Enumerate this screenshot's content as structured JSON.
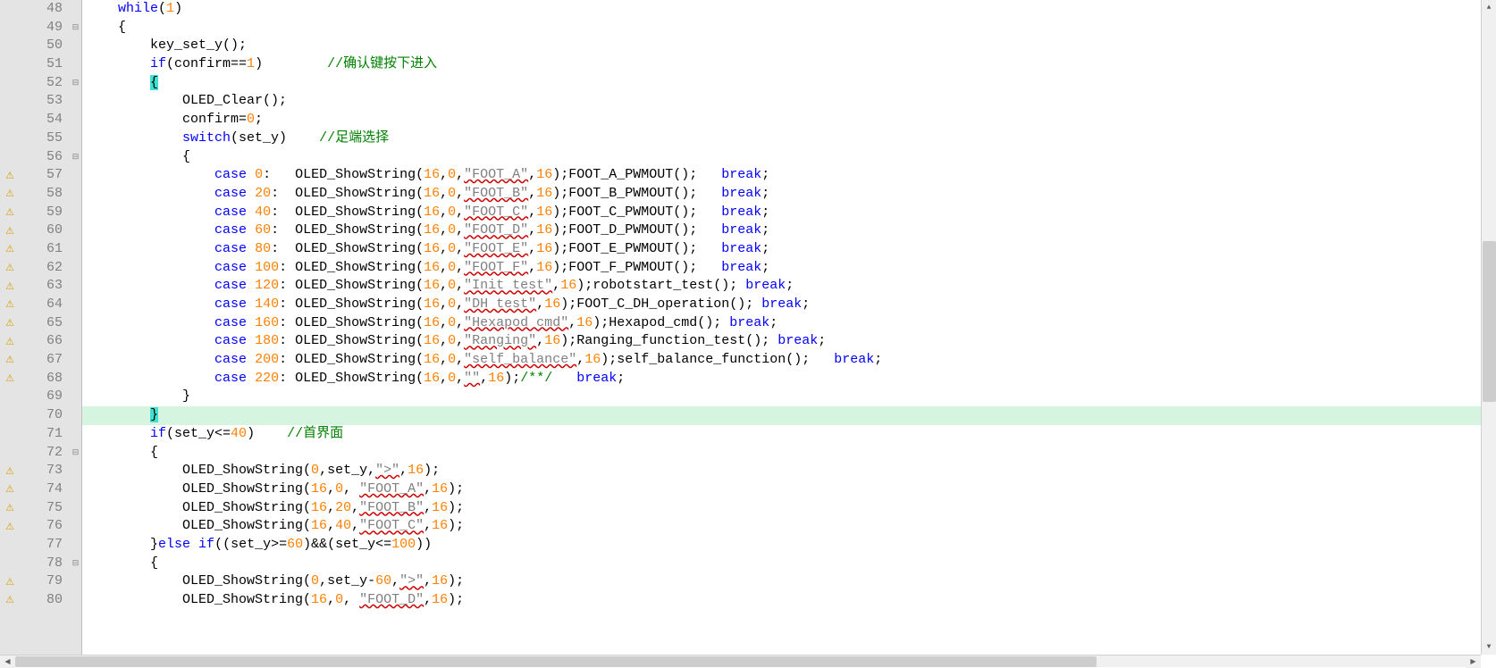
{
  "lines": [
    {
      "num": 48,
      "warn": false,
      "fold": "",
      "tokens": [
        [
          "    ",
          "ident"
        ],
        [
          "while",
          "kw"
        ],
        [
          "(",
          "ident"
        ],
        [
          "1",
          "num"
        ],
        [
          ")",
          "ident"
        ]
      ]
    },
    {
      "num": 49,
      "warn": false,
      "fold": "minus",
      "tokens": [
        [
          "    {",
          "ident"
        ]
      ]
    },
    {
      "num": 50,
      "warn": false,
      "fold": "",
      "tokens": [
        [
          "        key_set_y();",
          "ident"
        ]
      ]
    },
    {
      "num": 51,
      "warn": false,
      "fold": "",
      "tokens": [
        [
          "        ",
          "ident"
        ],
        [
          "if",
          "kw"
        ],
        [
          "(confirm==",
          "ident"
        ],
        [
          "1",
          "num"
        ],
        [
          ")        ",
          "ident"
        ],
        [
          "//确认键按下进入",
          "com"
        ]
      ]
    },
    {
      "num": 52,
      "warn": false,
      "fold": "minus",
      "tokens": [
        [
          "        ",
          "ident"
        ],
        [
          "{",
          "brace-hl"
        ]
      ]
    },
    {
      "num": 53,
      "warn": false,
      "fold": "",
      "tokens": [
        [
          "            OLED_Clear();",
          "ident"
        ]
      ]
    },
    {
      "num": 54,
      "warn": false,
      "fold": "",
      "tokens": [
        [
          "            confirm=",
          "ident"
        ],
        [
          "0",
          "num"
        ],
        [
          ";",
          "ident"
        ]
      ]
    },
    {
      "num": 55,
      "warn": false,
      "fold": "",
      "tokens": [
        [
          "            ",
          "ident"
        ],
        [
          "switch",
          "kw"
        ],
        [
          "(set_y)    ",
          "ident"
        ],
        [
          "//足端选择",
          "com"
        ]
      ]
    },
    {
      "num": 56,
      "warn": false,
      "fold": "minus",
      "tokens": [
        [
          "            {",
          "ident"
        ]
      ]
    },
    {
      "num": 57,
      "warn": true,
      "fold": "",
      "tokens": [
        [
          "                ",
          "ident"
        ],
        [
          "case",
          "kw"
        ],
        [
          " ",
          "ident"
        ],
        [
          "0",
          "num"
        ],
        [
          ":   OLED_ShowString(",
          "ident"
        ],
        [
          "16",
          "num"
        ],
        [
          ",",
          "ident"
        ],
        [
          "0",
          "num"
        ],
        [
          ",",
          "ident"
        ],
        [
          "\"FOOT_A\"",
          "str-underline"
        ],
        [
          ",",
          "ident"
        ],
        [
          "16",
          "num"
        ],
        [
          ");FOOT_A_PWMOUT();   ",
          "ident"
        ],
        [
          "break",
          "kw"
        ],
        [
          ";",
          "ident"
        ]
      ]
    },
    {
      "num": 58,
      "warn": true,
      "fold": "",
      "tokens": [
        [
          "                ",
          "ident"
        ],
        [
          "case",
          "kw"
        ],
        [
          " ",
          "ident"
        ],
        [
          "20",
          "num"
        ],
        [
          ":  OLED_ShowString(",
          "ident"
        ],
        [
          "16",
          "num"
        ],
        [
          ",",
          "ident"
        ],
        [
          "0",
          "num"
        ],
        [
          ",",
          "ident"
        ],
        [
          "\"FOOT_B\"",
          "str-underline"
        ],
        [
          ",",
          "ident"
        ],
        [
          "16",
          "num"
        ],
        [
          ");FOOT_B_PWMOUT();   ",
          "ident"
        ],
        [
          "break",
          "kw"
        ],
        [
          ";",
          "ident"
        ]
      ]
    },
    {
      "num": 59,
      "warn": true,
      "fold": "",
      "tokens": [
        [
          "                ",
          "ident"
        ],
        [
          "case",
          "kw"
        ],
        [
          " ",
          "ident"
        ],
        [
          "40",
          "num"
        ],
        [
          ":  OLED_ShowString(",
          "ident"
        ],
        [
          "16",
          "num"
        ],
        [
          ",",
          "ident"
        ],
        [
          "0",
          "num"
        ],
        [
          ",",
          "ident"
        ],
        [
          "\"FOOT_C\"",
          "str-underline"
        ],
        [
          ",",
          "ident"
        ],
        [
          "16",
          "num"
        ],
        [
          ");FOOT_C_PWMOUT();   ",
          "ident"
        ],
        [
          "break",
          "kw"
        ],
        [
          ";",
          "ident"
        ]
      ]
    },
    {
      "num": 60,
      "warn": true,
      "fold": "",
      "tokens": [
        [
          "                ",
          "ident"
        ],
        [
          "case",
          "kw"
        ],
        [
          " ",
          "ident"
        ],
        [
          "60",
          "num"
        ],
        [
          ":  OLED_ShowString(",
          "ident"
        ],
        [
          "16",
          "num"
        ],
        [
          ",",
          "ident"
        ],
        [
          "0",
          "num"
        ],
        [
          ",",
          "ident"
        ],
        [
          "\"FOOT_D\"",
          "str-underline"
        ],
        [
          ",",
          "ident"
        ],
        [
          "16",
          "num"
        ],
        [
          ");FOOT_D_PWMOUT();   ",
          "ident"
        ],
        [
          "break",
          "kw"
        ],
        [
          ";",
          "ident"
        ]
      ]
    },
    {
      "num": 61,
      "warn": true,
      "fold": "",
      "tokens": [
        [
          "                ",
          "ident"
        ],
        [
          "case",
          "kw"
        ],
        [
          " ",
          "ident"
        ],
        [
          "80",
          "num"
        ],
        [
          ":  OLED_ShowString(",
          "ident"
        ],
        [
          "16",
          "num"
        ],
        [
          ",",
          "ident"
        ],
        [
          "0",
          "num"
        ],
        [
          ",",
          "ident"
        ],
        [
          "\"FOOT_E\"",
          "str-underline"
        ],
        [
          ",",
          "ident"
        ],
        [
          "16",
          "num"
        ],
        [
          ");FOOT_E_PWMOUT();   ",
          "ident"
        ],
        [
          "break",
          "kw"
        ],
        [
          ";",
          "ident"
        ]
      ]
    },
    {
      "num": 62,
      "warn": true,
      "fold": "",
      "tokens": [
        [
          "                ",
          "ident"
        ],
        [
          "case",
          "kw"
        ],
        [
          " ",
          "ident"
        ],
        [
          "100",
          "num"
        ],
        [
          ": OLED_ShowString(",
          "ident"
        ],
        [
          "16",
          "num"
        ],
        [
          ",",
          "ident"
        ],
        [
          "0",
          "num"
        ],
        [
          ",",
          "ident"
        ],
        [
          "\"FOOT_F\"",
          "str-underline"
        ],
        [
          ",",
          "ident"
        ],
        [
          "16",
          "num"
        ],
        [
          ");FOOT_F_PWMOUT();   ",
          "ident"
        ],
        [
          "break",
          "kw"
        ],
        [
          ";",
          "ident"
        ]
      ]
    },
    {
      "num": 63,
      "warn": true,
      "fold": "",
      "tokens": [
        [
          "                ",
          "ident"
        ],
        [
          "case",
          "kw"
        ],
        [
          " ",
          "ident"
        ],
        [
          "120",
          "num"
        ],
        [
          ": OLED_ShowString(",
          "ident"
        ],
        [
          "16",
          "num"
        ],
        [
          ",",
          "ident"
        ],
        [
          "0",
          "num"
        ],
        [
          ",",
          "ident"
        ],
        [
          "\"Init test\"",
          "str-underline"
        ],
        [
          ",",
          "ident"
        ],
        [
          "16",
          "num"
        ],
        [
          ");robotstart_test(); ",
          "ident"
        ],
        [
          "break",
          "kw"
        ],
        [
          ";",
          "ident"
        ]
      ]
    },
    {
      "num": 64,
      "warn": true,
      "fold": "",
      "tokens": [
        [
          "                ",
          "ident"
        ],
        [
          "case",
          "kw"
        ],
        [
          " ",
          "ident"
        ],
        [
          "140",
          "num"
        ],
        [
          ": OLED_ShowString(",
          "ident"
        ],
        [
          "16",
          "num"
        ],
        [
          ",",
          "ident"
        ],
        [
          "0",
          "num"
        ],
        [
          ",",
          "ident"
        ],
        [
          "\"DH test\"",
          "str-underline"
        ],
        [
          ",",
          "ident"
        ],
        [
          "16",
          "num"
        ],
        [
          ");FOOT_C_DH_operation(); ",
          "ident"
        ],
        [
          "break",
          "kw"
        ],
        [
          ";",
          "ident"
        ]
      ]
    },
    {
      "num": 65,
      "warn": true,
      "fold": "",
      "tokens": [
        [
          "                ",
          "ident"
        ],
        [
          "case",
          "kw"
        ],
        [
          " ",
          "ident"
        ],
        [
          "160",
          "num"
        ],
        [
          ": OLED_ShowString(",
          "ident"
        ],
        [
          "16",
          "num"
        ],
        [
          ",",
          "ident"
        ],
        [
          "0",
          "num"
        ],
        [
          ",",
          "ident"
        ],
        [
          "\"Hexapod cmd\"",
          "str-underline"
        ],
        [
          ",",
          "ident"
        ],
        [
          "16",
          "num"
        ],
        [
          ");Hexapod_cmd(); ",
          "ident"
        ],
        [
          "break",
          "kw"
        ],
        [
          ";",
          "ident"
        ]
      ]
    },
    {
      "num": 66,
      "warn": true,
      "fold": "",
      "tokens": [
        [
          "                ",
          "ident"
        ],
        [
          "case",
          "kw"
        ],
        [
          " ",
          "ident"
        ],
        [
          "180",
          "num"
        ],
        [
          ": OLED_ShowString(",
          "ident"
        ],
        [
          "16",
          "num"
        ],
        [
          ",",
          "ident"
        ],
        [
          "0",
          "num"
        ],
        [
          ",",
          "ident"
        ],
        [
          "\"Ranging\"",
          "str-underline"
        ],
        [
          ",",
          "ident"
        ],
        [
          "16",
          "num"
        ],
        [
          ");Ranging_function_test(); ",
          "ident"
        ],
        [
          "break",
          "kw"
        ],
        [
          ";",
          "ident"
        ]
      ]
    },
    {
      "num": 67,
      "warn": true,
      "fold": "",
      "tokens": [
        [
          "                ",
          "ident"
        ],
        [
          "case",
          "kw"
        ],
        [
          " ",
          "ident"
        ],
        [
          "200",
          "num"
        ],
        [
          ": OLED_ShowString(",
          "ident"
        ],
        [
          "16",
          "num"
        ],
        [
          ",",
          "ident"
        ],
        [
          "0",
          "num"
        ],
        [
          ",",
          "ident"
        ],
        [
          "\"self_balance\"",
          "str-underline"
        ],
        [
          ",",
          "ident"
        ],
        [
          "16",
          "num"
        ],
        [
          ");self_balance_function();   ",
          "ident"
        ],
        [
          "break",
          "kw"
        ],
        [
          ";",
          "ident"
        ]
      ]
    },
    {
      "num": 68,
      "warn": true,
      "fold": "",
      "tokens": [
        [
          "                ",
          "ident"
        ],
        [
          "case",
          "kw"
        ],
        [
          " ",
          "ident"
        ],
        [
          "220",
          "num"
        ],
        [
          ": OLED_ShowString(",
          "ident"
        ],
        [
          "16",
          "num"
        ],
        [
          ",",
          "ident"
        ],
        [
          "0",
          "num"
        ],
        [
          ",",
          "ident"
        ],
        [
          "\"\"",
          "str-underline"
        ],
        [
          ",",
          "ident"
        ],
        [
          "16",
          "num"
        ],
        [
          ");",
          "ident"
        ],
        [
          "/**/",
          "com"
        ],
        [
          "   ",
          "ident"
        ],
        [
          "break",
          "kw"
        ],
        [
          ";",
          "ident"
        ]
      ]
    },
    {
      "num": 69,
      "warn": false,
      "fold": "",
      "tokens": [
        [
          "            }",
          "ident"
        ]
      ]
    },
    {
      "num": 70,
      "warn": false,
      "fold": "",
      "hl": true,
      "tokens": [
        [
          "        ",
          "ident"
        ],
        [
          "}",
          "brace-hl"
        ]
      ]
    },
    {
      "num": 71,
      "warn": false,
      "fold": "",
      "tokens": [
        [
          "        ",
          "ident"
        ],
        [
          "if",
          "kw"
        ],
        [
          "(set_y<=",
          "ident"
        ],
        [
          "40",
          "num"
        ],
        [
          ")    ",
          "ident"
        ],
        [
          "//首界面",
          "com"
        ]
      ]
    },
    {
      "num": 72,
      "warn": false,
      "fold": "minus",
      "tokens": [
        [
          "        {",
          "ident"
        ]
      ]
    },
    {
      "num": 73,
      "warn": true,
      "fold": "",
      "tokens": [
        [
          "            OLED_ShowString(",
          "ident"
        ],
        [
          "0",
          "num"
        ],
        [
          ",set_y,",
          "ident"
        ],
        [
          "\">\"",
          "str-underline"
        ],
        [
          ",",
          "ident"
        ],
        [
          "16",
          "num"
        ],
        [
          ");",
          "ident"
        ]
      ]
    },
    {
      "num": 74,
      "warn": true,
      "fold": "",
      "tokens": [
        [
          "            OLED_ShowString(",
          "ident"
        ],
        [
          "16",
          "num"
        ],
        [
          ",",
          "ident"
        ],
        [
          "0",
          "num"
        ],
        [
          ", ",
          "ident"
        ],
        [
          "\"FOOT_A\"",
          "str-underline"
        ],
        [
          ",",
          "ident"
        ],
        [
          "16",
          "num"
        ],
        [
          ");",
          "ident"
        ]
      ]
    },
    {
      "num": 75,
      "warn": true,
      "fold": "",
      "tokens": [
        [
          "            OLED_ShowString(",
          "ident"
        ],
        [
          "16",
          "num"
        ],
        [
          ",",
          "ident"
        ],
        [
          "20",
          "num"
        ],
        [
          ",",
          "ident"
        ],
        [
          "\"FOOT_B\"",
          "str-underline"
        ],
        [
          ",",
          "ident"
        ],
        [
          "16",
          "num"
        ],
        [
          ");",
          "ident"
        ]
      ]
    },
    {
      "num": 76,
      "warn": true,
      "fold": "",
      "tokens": [
        [
          "            OLED_ShowString(",
          "ident"
        ],
        [
          "16",
          "num"
        ],
        [
          ",",
          "ident"
        ],
        [
          "40",
          "num"
        ],
        [
          ",",
          "ident"
        ],
        [
          "\"FOOT_C\"",
          "str-underline"
        ],
        [
          ",",
          "ident"
        ],
        [
          "16",
          "num"
        ],
        [
          ");",
          "ident"
        ]
      ]
    },
    {
      "num": 77,
      "warn": false,
      "fold": "",
      "tokens": [
        [
          "        }",
          "ident"
        ],
        [
          "else",
          "kw"
        ],
        [
          " ",
          "ident"
        ],
        [
          "if",
          "kw"
        ],
        [
          "((set_y>=",
          "ident"
        ],
        [
          "60",
          "num"
        ],
        [
          ")&&(set_y<=",
          "ident"
        ],
        [
          "100",
          "num"
        ],
        [
          "))",
          "ident"
        ]
      ]
    },
    {
      "num": 78,
      "warn": false,
      "fold": "minus",
      "tokens": [
        [
          "        {",
          "ident"
        ]
      ]
    },
    {
      "num": 79,
      "warn": true,
      "fold": "",
      "tokens": [
        [
          "            OLED_ShowString(",
          "ident"
        ],
        [
          "0",
          "num"
        ],
        [
          ",set_y-",
          "ident"
        ],
        [
          "60",
          "num"
        ],
        [
          ",",
          "ident"
        ],
        [
          "\">\"",
          "str-underline"
        ],
        [
          ",",
          "ident"
        ],
        [
          "16",
          "num"
        ],
        [
          ");",
          "ident"
        ]
      ]
    },
    {
      "num": 80,
      "warn": true,
      "fold": "",
      "tokens": [
        [
          "            OLED_ShowString(",
          "ident"
        ],
        [
          "16",
          "num"
        ],
        [
          ",",
          "ident"
        ],
        [
          "0",
          "num"
        ],
        [
          ", ",
          "ident"
        ],
        [
          "\"FOOT_D\"",
          "str-underline"
        ],
        [
          ",",
          "ident"
        ],
        [
          "16",
          "num"
        ],
        [
          ");",
          "ident"
        ]
      ]
    }
  ]
}
